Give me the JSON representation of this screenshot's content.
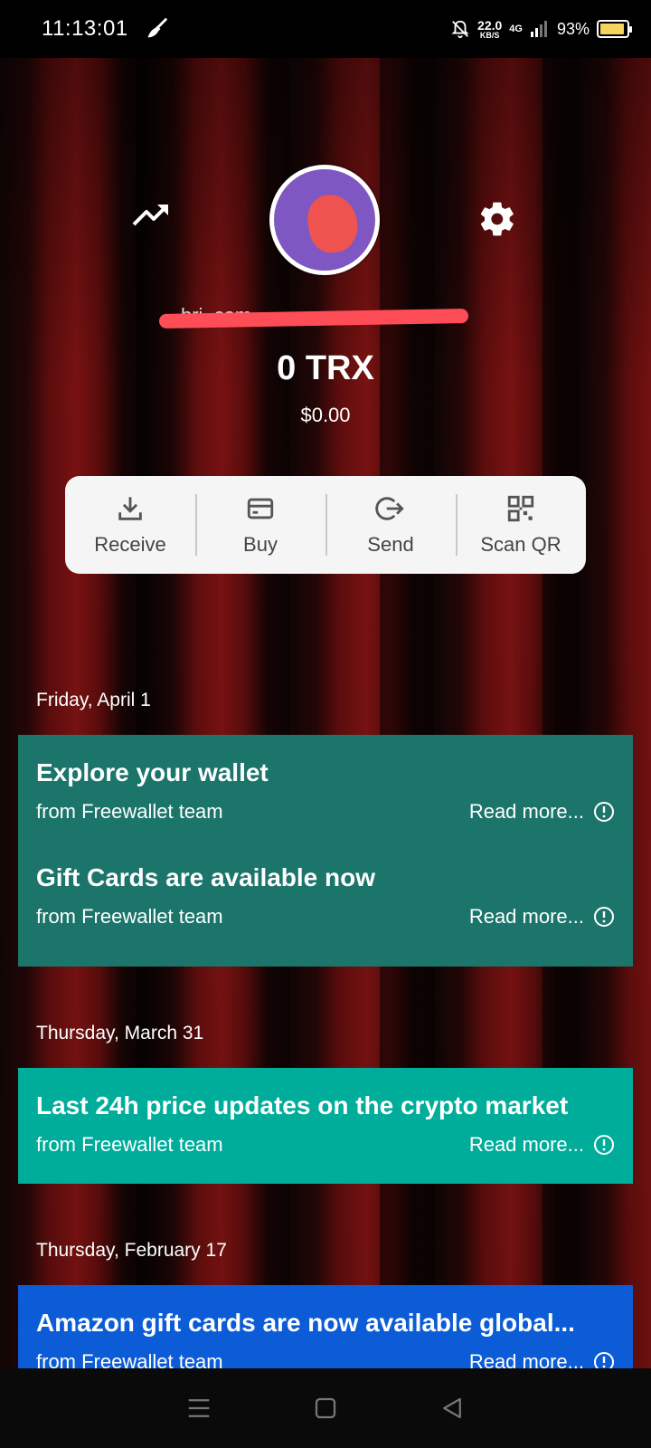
{
  "status_bar": {
    "time": "11:13:01",
    "net_speed_value": "22.0",
    "net_speed_unit": "KB/S",
    "network": "4G",
    "battery_pct": "93%",
    "battery_level": 0.93
  },
  "header": {
    "email_visible": "bri                       .com",
    "balance": "0 TRX",
    "fiat_balance": "$0.00"
  },
  "actions": [
    {
      "label": "Receive",
      "icon": "download-icon"
    },
    {
      "label": "Buy",
      "icon": "card-icon"
    },
    {
      "label": "Send",
      "icon": "send-icon"
    },
    {
      "label": "Scan QR",
      "icon": "qr-icon"
    }
  ],
  "feed": [
    {
      "date": "Friday, April 1",
      "color": "#1c756b",
      "items": [
        {
          "title": "Explore your wallet",
          "from": "from Freewallet team",
          "read_more": "Read more..."
        },
        {
          "title": "Gift Cards are available now",
          "from": "from Freewallet team",
          "read_more": "Read more..."
        }
      ]
    },
    {
      "date": "Thursday, March 31",
      "color": "#00ad9b",
      "items": [
        {
          "title": "Last 24h price updates on the crypto market",
          "from": "from Freewallet team",
          "read_more": "Read more..."
        }
      ]
    },
    {
      "date": "Thursday, February 17",
      "color": "#0b5cd6",
      "items": [
        {
          "title": "Amazon gift cards are now available global...",
          "from": "from Freewallet team",
          "read_more": "Read more..."
        }
      ]
    }
  ]
}
